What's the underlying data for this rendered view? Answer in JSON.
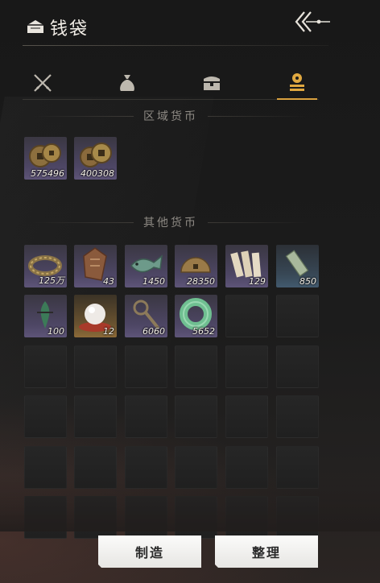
{
  "header": {
    "title": "钱袋"
  },
  "tabs": [
    {
      "icon": "crossed-swords-icon",
      "active": false
    },
    {
      "icon": "money-bag-icon",
      "active": false
    },
    {
      "icon": "treasure-chest-icon",
      "active": false
    },
    {
      "icon": "coin-stack-icon",
      "active": true
    }
  ],
  "regional": {
    "title": "区域货币",
    "items": [
      {
        "icon": "copper-coins-icon",
        "count": "575496",
        "rarity": "purple"
      },
      {
        "icon": "copper-coins-icon",
        "count": "400308",
        "rarity": "purple"
      }
    ]
  },
  "other": {
    "title": "其他货币",
    "items": [
      {
        "icon": "coin-string-icon",
        "count": "125万",
        "rarity": "purple"
      },
      {
        "icon": "bronze-token-icon",
        "count": "43",
        "rarity": "purple"
      },
      {
        "icon": "jade-fish-icon",
        "count": "1450",
        "rarity": "purple"
      },
      {
        "icon": "bronze-half-coin-icon",
        "count": "28350",
        "rarity": "purple"
      },
      {
        "icon": "bamboo-slips-icon",
        "count": "129",
        "rarity": "purple"
      },
      {
        "icon": "jade-tablet-icon",
        "count": "850",
        "rarity": "blue"
      },
      {
        "icon": "green-flame-icon",
        "count": "100",
        "rarity": "purple"
      },
      {
        "icon": "pearl-icon",
        "count": "12",
        "rarity": "gold"
      },
      {
        "icon": "spade-coin-icon",
        "count": "6060",
        "rarity": "purple"
      },
      {
        "icon": "jade-ring-icon",
        "count": "5652",
        "rarity": "purple"
      }
    ]
  },
  "buttons": {
    "craft": "制造",
    "sort": "整理"
  },
  "colors": {
    "accent": "#d9a13f",
    "purple_slot": "#4d4664",
    "gold_slot": "#6a5330",
    "blue_slot": "#384856"
  }
}
